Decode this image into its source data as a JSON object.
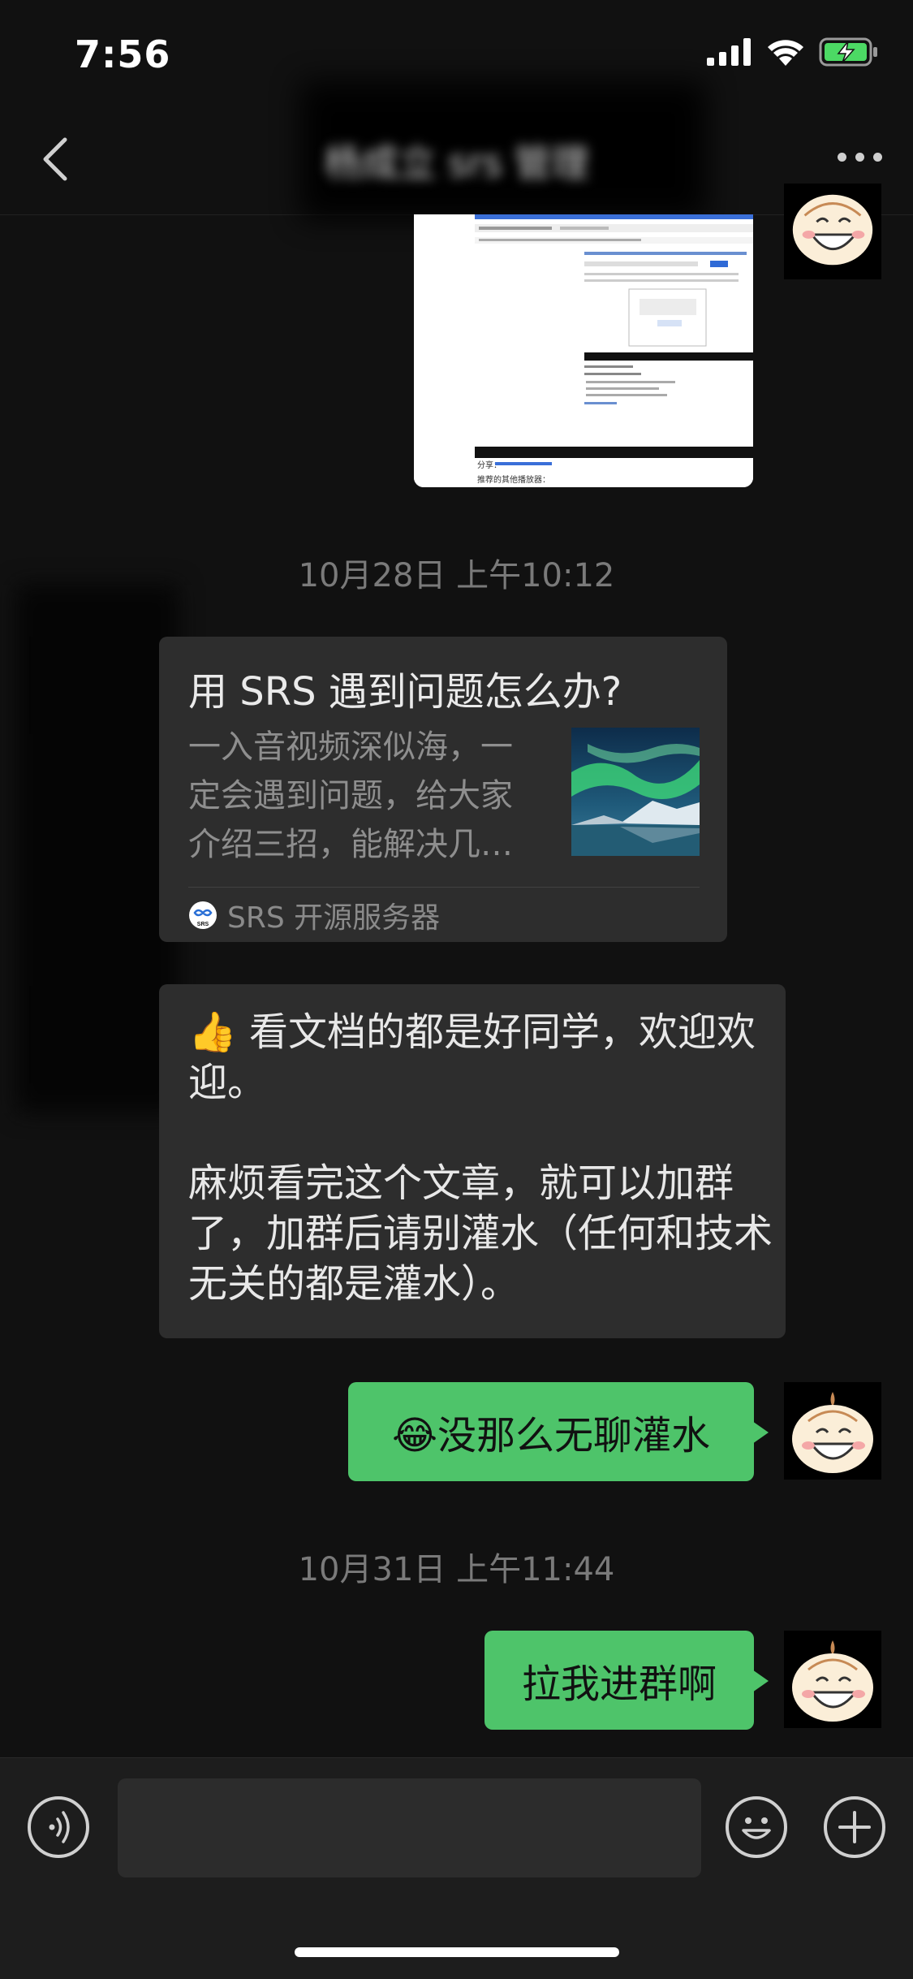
{
  "status_bar": {
    "time": "7:56",
    "icons": [
      "signal-icon",
      "wifi-icon",
      "battery-charging-icon"
    ]
  },
  "nav": {
    "title": "杨成立 srs 管理",
    "back_icon": "chevron-left-icon",
    "more_icon": "more-dots-icon"
  },
  "messages": {
    "screenshot_caption_a": "分享：",
    "screenshot_caption_b": "推荐的其他播放器：",
    "timestamp1": "10月28日 上午10:12",
    "card": {
      "title": "用 SRS 遇到问题怎么办?",
      "desc": "一入音视频深似海，一定会遇到问题，给大家介绍三招，能解决几…",
      "source": "SRS 开源服务器",
      "source_logo_text": "SRS"
    },
    "text_message": "👍 看文档的都是好同学，欢迎欢迎。\n\n麻烦看完这个文章，就可以加群了，加群后请别灌水（任何和技术无关的都是灌水）。",
    "reply1": "😂没那么无聊灌水",
    "timestamp2": "10月31日 上午11:44",
    "reply2": "拉我进群啊"
  },
  "input_bar": {
    "voice_icon": "voice-icon",
    "emoji_icon": "emoji-icon",
    "plus_icon": "plus-icon"
  },
  "colors": {
    "background": "#111111",
    "bubble_incoming": "#2d2d2d",
    "bubble_outgoing": "#4ec46a"
  }
}
